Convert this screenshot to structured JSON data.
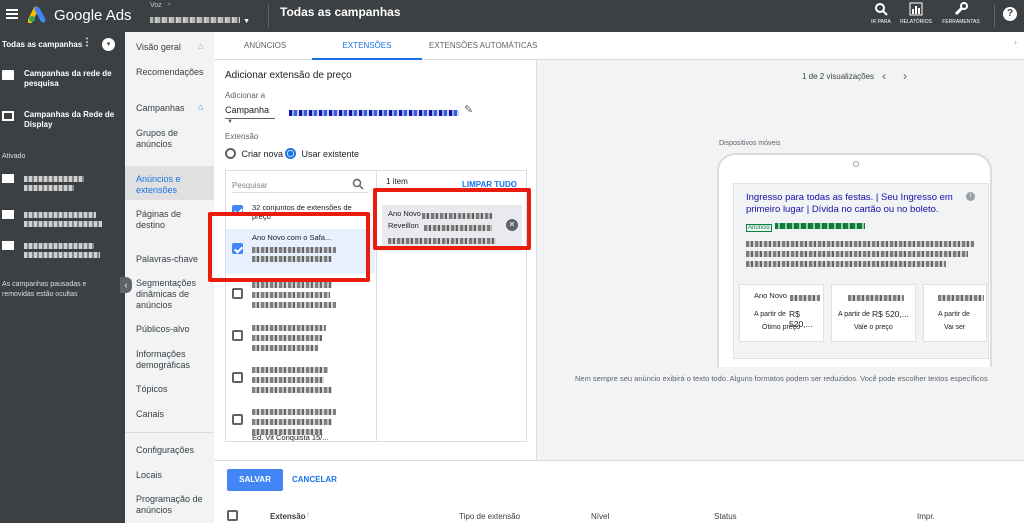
{
  "topbar": {
    "product": "Google Ads",
    "account_label": "Voz",
    "page_title": "Todas as campanhas",
    "tools": [
      {
        "label": "IR PARA",
        "icon": "search-icon"
      },
      {
        "label": "RELATÓRIOS",
        "icon": "chart-icon"
      },
      {
        "label": "FERRAMENTAS",
        "icon": "wrench-icon"
      }
    ]
  },
  "leftpanel": {
    "all_campaigns": "Todas as campanhas",
    "campaigns": [
      {
        "name": "Campanhas da rede de pesquisa"
      },
      {
        "name": "Campanhas da Rede de Display"
      }
    ],
    "active_label": "Ativado",
    "paused_note": "As campanhas pausadas e removidas estão ocultas"
  },
  "nav": {
    "items": [
      "Visão geral",
      "Recomendações",
      "Campanhas",
      "Grupos de anúncios",
      "Anúncios e extensões",
      "Páginas de destino",
      "Palavras-chave",
      "Segmentações dinâmicas de anúncios",
      "Públicos-alvo",
      "Informações demográficas",
      "Tópicos",
      "Canais",
      "Configurações",
      "Locais",
      "Programação de anúncios"
    ]
  },
  "tabs": [
    "ANÚNCIOS",
    "EXTENSÕES",
    "EXTENSÕES AUTOMÁTICAS"
  ],
  "editor": {
    "title": "Adicionar extensão de preço",
    "add_to_label": "Adicionar a",
    "add_to_value": "Campanha",
    "extension_label": "Extensão",
    "radio_new": "Criar nova",
    "radio_existing": "Usar existente",
    "search_placeholder": "Pesquisar",
    "selected_count": "1 item",
    "clear_all": "LIMPAR TUDO",
    "sets_label": "32 conjuntos de extensões de preço",
    "list": [
      {
        "title": "Ano Novo com o Safa...",
        "checked": true
      },
      {
        "title": "",
        "checked": false
      },
      {
        "title": "",
        "checked": false
      },
      {
        "title": "",
        "checked": false
      },
      {
        "title": "",
        "checked": false
      },
      {
        "title": "Ed. Vit Conquista 15/...",
        "checked": false
      }
    ],
    "selected_item": {
      "line1": "Ano Novo",
      "line2": "Reveillon"
    }
  },
  "preview": {
    "counter": "1 de 2 visualizações",
    "device": "Dispositivos móveis",
    "ad_headline": "Ingresso para todas as festas. | Seu Ingresso em primeiro lugar | Dívida no cartão ou no boleto.",
    "ad_badge": "Anúncio",
    "cards": [
      {
        "title": "Ano Novo",
        "from": "A partir de",
        "price": "R$ 520,...",
        "sub": "Ótimo preço"
      },
      {
        "title": "",
        "from": "A partir de",
        "price": "R$ 520,...",
        "sub": "Vale o preço"
      },
      {
        "title": "",
        "from": "A partir de",
        "price": "",
        "sub": "Vai ser"
      }
    ],
    "note": "Nem sempre seu anúncio exibirá o texto todo. Alguns formatos podem ser reduzidos. Você pode escolher textos específicos"
  },
  "footer": {
    "save": "SALVAR",
    "cancel": "CANCELAR",
    "columns": [
      "Extensão",
      "Tipo de extensão",
      "Nível",
      "Status",
      "Impr."
    ]
  },
  "colors": {
    "accent": "#1a73e8",
    "highlight": "#ea1c0e",
    "dark": "#3c4043"
  }
}
